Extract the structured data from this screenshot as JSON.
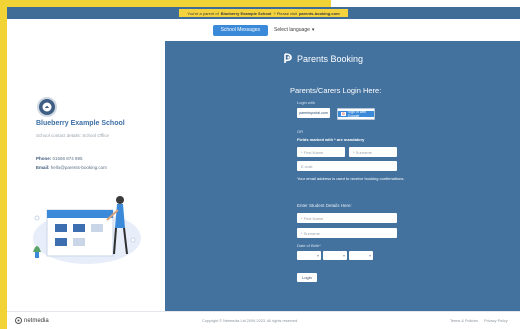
{
  "banner": {
    "prefix": "You're a parent of",
    "school": "Blueberry Example School",
    "middle": "? Please visit",
    "link": "parents-booking.com"
  },
  "navbar": {
    "messages_button": "School Messages",
    "language_select": "Select language"
  },
  "school": {
    "name": "Blueberry Example School",
    "contact_details": "School contact details: School Office",
    "phone_label": "Phone:",
    "phone_value": "01566 874 895",
    "email_label": "Email:",
    "email_value": "hello@parents-booking.com"
  },
  "login": {
    "brand": "Parents Booking",
    "title": "Parents/Carers Login Here:",
    "login_with": "Login with",
    "parentsportal_button": "parentsportal.com",
    "google_button": "Sign in with Google",
    "or": "OR",
    "required_note": "Fields marked with * are mandatory",
    "first_name_placeholder": "* First Name",
    "surname_placeholder": "* Surname",
    "email_placeholder": "E-mail",
    "email_note": "Your email address is used to receive booking confirmations.",
    "student_heading": "Enter Student Details Here:",
    "student_first_name_placeholder": "* First Name",
    "student_surname_placeholder": "* Surname",
    "dob_label": "Date of Birth*",
    "login_button": "Login"
  },
  "footer": {
    "logo": "netmedia",
    "copyright": "Copyright © Netmedia Ltd 2009-2023. All rights reserved.",
    "terms": "Terms & Policies",
    "privacy": "Privacy Policy"
  },
  "colors": {
    "panel_blue": "#43729f",
    "banner_yellow": "#f3d23e",
    "school_name_blue": "#3b6ea6",
    "button_blue": "#3b8ad9"
  }
}
